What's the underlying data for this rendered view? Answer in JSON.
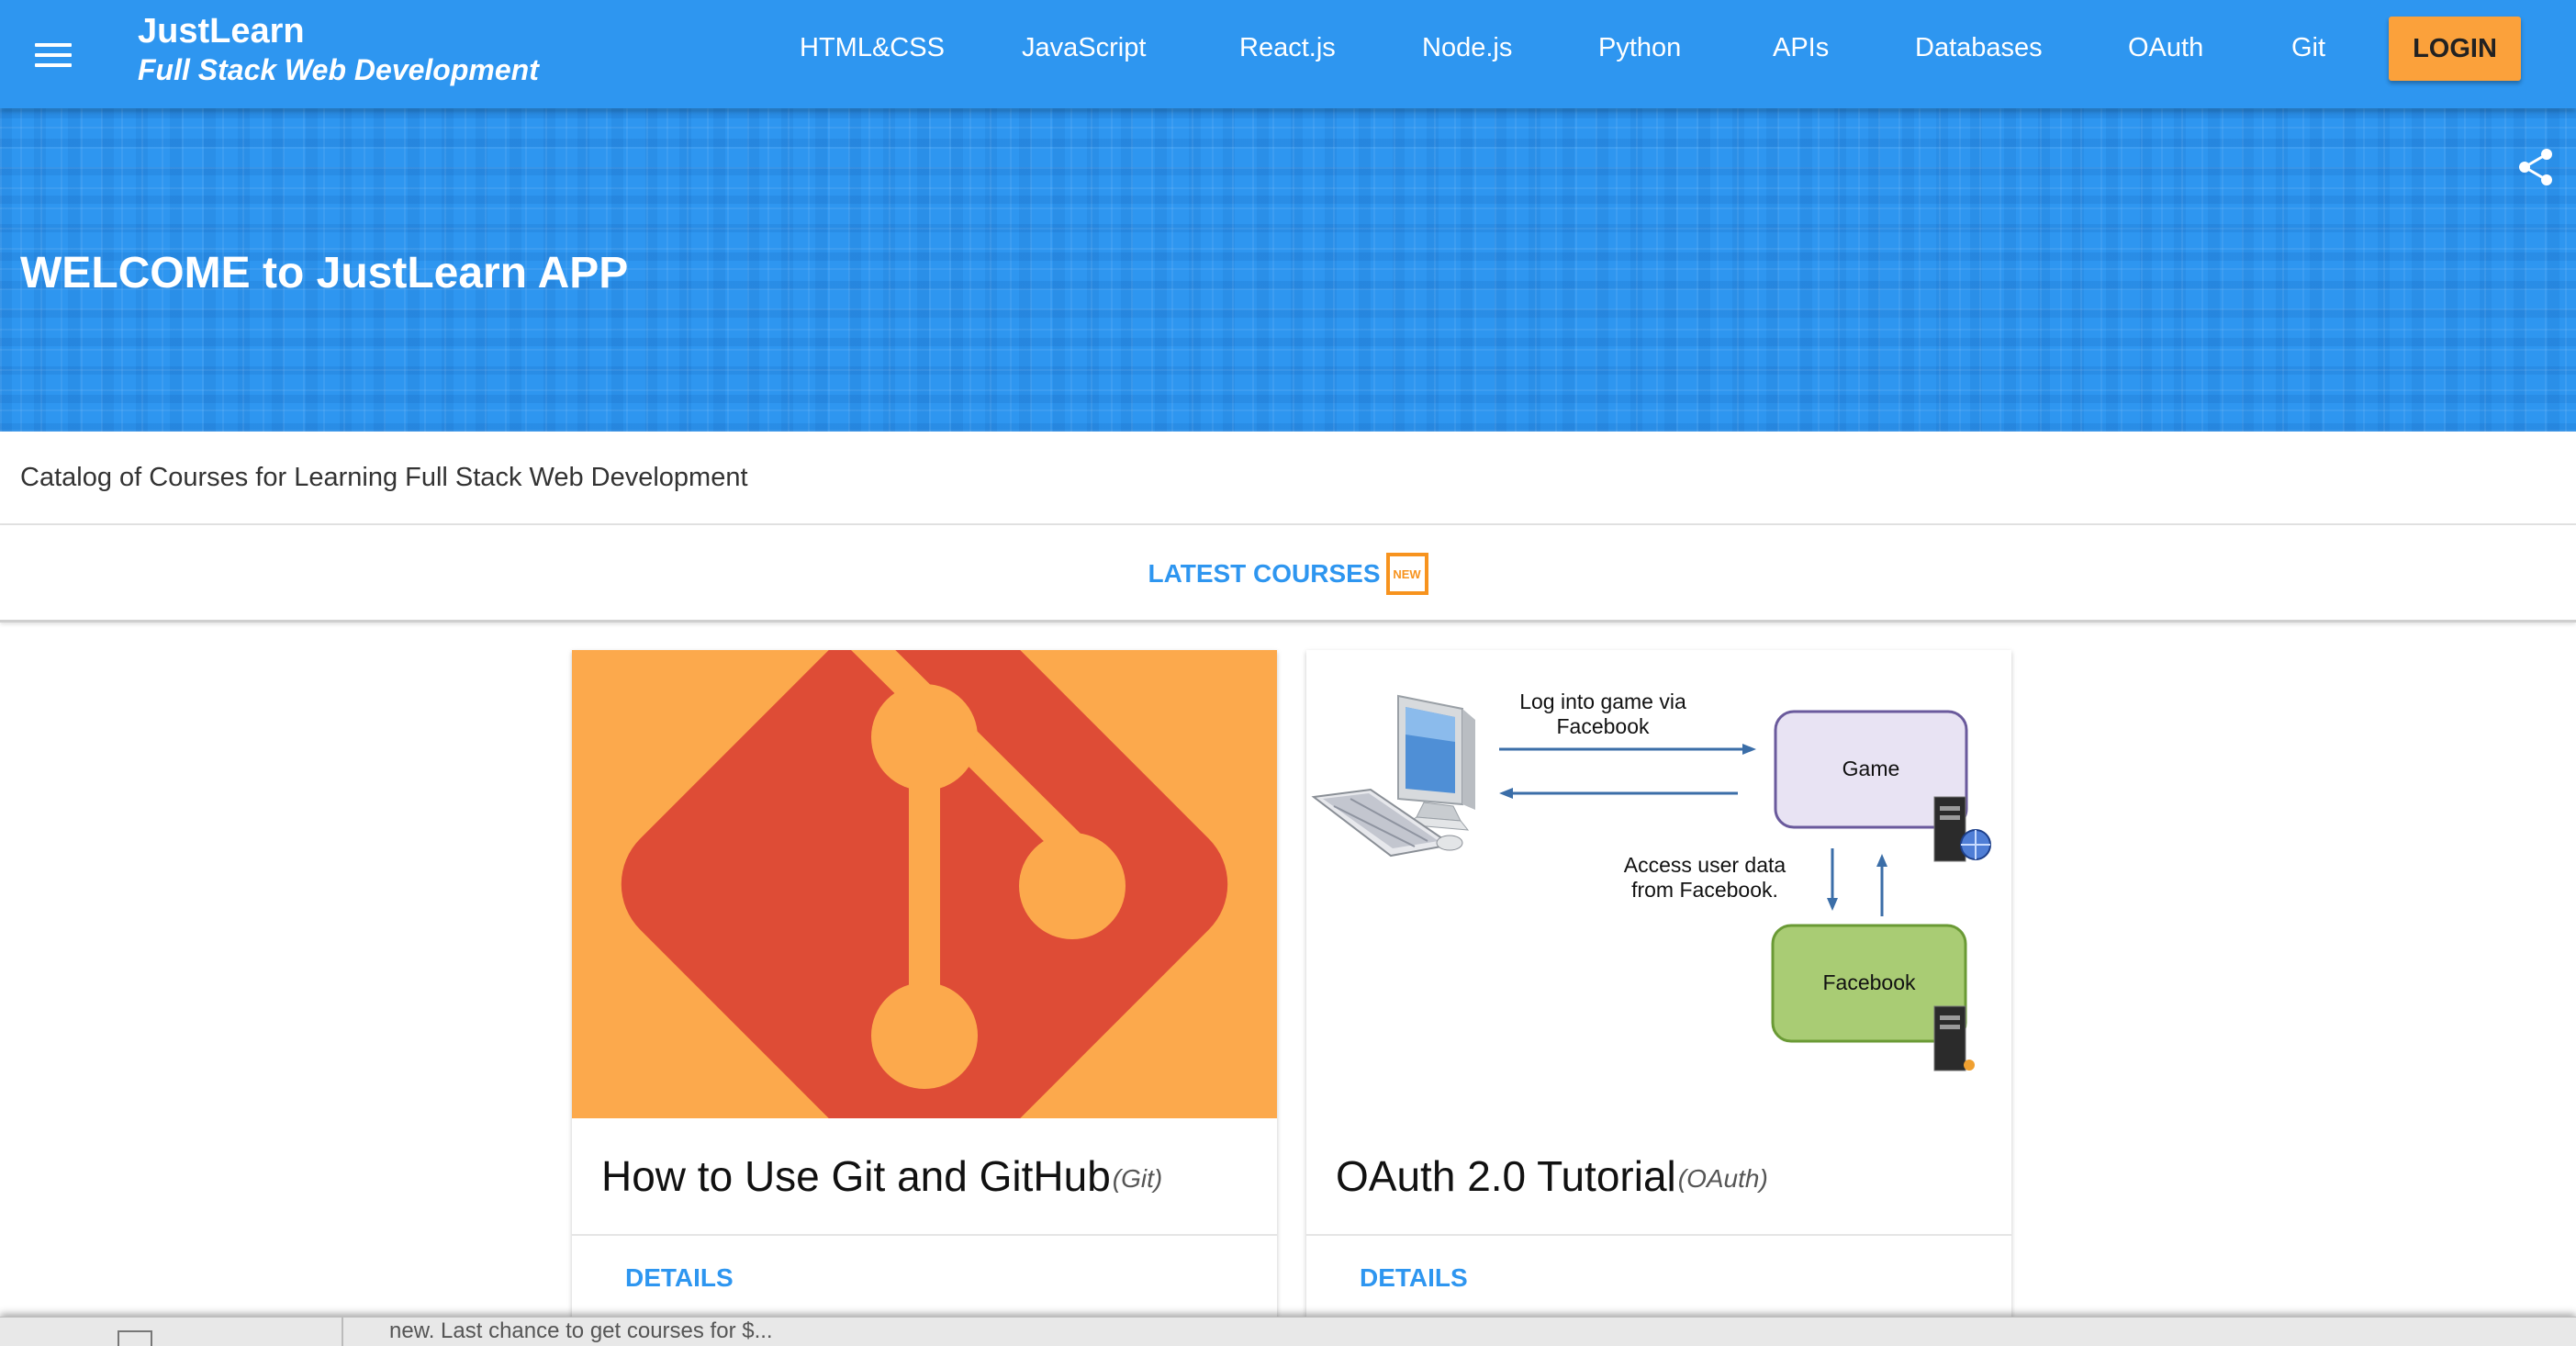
{
  "brand": {
    "name": "JustLearn",
    "subtitle": "Full Stack Web Development"
  },
  "nav": {
    "items": [
      "HTML&CSS",
      "JavaScript",
      "React.js",
      "Node.js",
      "Python",
      "APIs",
      "Databases",
      "OAuth",
      "Git"
    ],
    "login_label": "LOGIN"
  },
  "hero": {
    "title": "WELCOME to JustLearn APP"
  },
  "catalog": {
    "text": "Catalog of Courses for Learning Full Stack Web Development"
  },
  "latest": {
    "label": "LATEST COURSES",
    "badge": "NEW"
  },
  "courses": [
    {
      "title": "How to Use Git and GitHub",
      "tag": "(Git)",
      "action": "DETAILS",
      "image": "git-logo"
    },
    {
      "title": "OAuth 2.0 Tutorial",
      "tag": "(OAuth)",
      "action": "DETAILS",
      "image": "oauth-diagram",
      "diagram": {
        "arrow_top_label_1": "Log into game via",
        "arrow_top_label_2": "Facebook",
        "game_box": "Game",
        "facebook_box": "Facebook",
        "access_label_1": "Access user data",
        "access_label_2": "from Facebook."
      }
    }
  ],
  "bottom_peek": {
    "text": "new. Last chance to get courses for $..."
  },
  "colors": {
    "primary": "#2e96f0",
    "accent": "#fba13b",
    "git_red": "#de4c36",
    "git_orange": "#fca94c"
  }
}
